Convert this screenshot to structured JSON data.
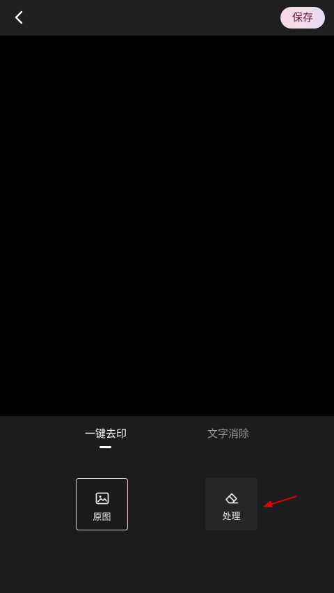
{
  "header": {
    "back_icon": "chevron-left-icon",
    "save_label": "保存"
  },
  "tabs": [
    {
      "label": "一键去印",
      "active": true
    },
    {
      "label": "文字消除",
      "active": false
    }
  ],
  "tools": [
    {
      "label": "原图",
      "icon": "image-icon",
      "selected": true
    },
    {
      "label": "处理",
      "icon": "eraser-icon",
      "selected": false
    }
  ],
  "colors": {
    "background": "#1c1c1e",
    "canvas": "#000000",
    "accent_border": "#e7c9d8",
    "save_text": "#6b1a3c",
    "annotation_arrow": "#e00000"
  }
}
